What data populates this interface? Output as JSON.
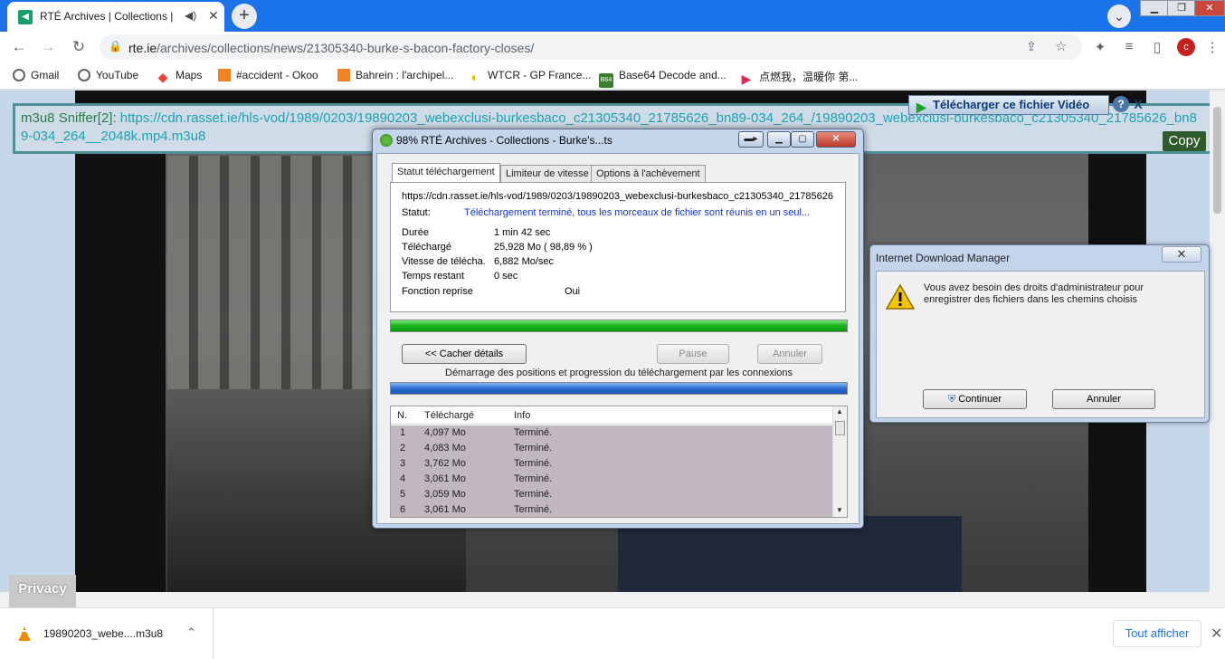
{
  "browser": {
    "tab_title": "RTÉ Archives | Collections | B",
    "tab_speaker": "◀)",
    "new_tab": "+",
    "url_domain": "rte.ie",
    "url_path": "/archives/collections/news/21305340-burke-s-bacon-factory-closes/",
    "profile_initial": "c",
    "bookmarks": [
      "Gmail",
      "YouTube",
      "Maps",
      "#accident - Okoo",
      "Bahrein : l'archipel...",
      "WTCR - GP France...",
      "Base64 Decode and...",
      "点燃我，温暖你 第..."
    ],
    "bookmark_icon_b64": "B64"
  },
  "page": {
    "sniffer_label": "m3u8 Sniffer[2]: ",
    "sniffer_url": "https://cdn.rasset.ie/hls-vod/1989/0203/19890203_webexclusi-burkesbaco_c21305340_21785626_bn89-034_264_/19890203_webexclusi-burkesbaco_c21305340_21785626_bn89-034_264__2048k.mp4.m3u8",
    "copy_label": "Copy",
    "tv_button": "Télécharger ce fichier Vidéo",
    "tv_help": "?",
    "tv_close": "X",
    "privacy": "Privacy"
  },
  "idm": {
    "title": "98% RTÉ Archives - Collections - Burke's...ts",
    "tabs": [
      "Statut téléchargement",
      "Limiteur de vitesse",
      "Options à l'achèvement"
    ],
    "url": "https://cdn.rasset.ie/hls-vod/1989/0203/19890203_webexclusi-burkesbaco_c21305340_21785626",
    "status_label": "Statut:",
    "status_value": "Téléchargement terminé, tous les morceaux de fichier sont réunis en un seul...",
    "rows": [
      {
        "label": "Durée",
        "value": "1 min 42 sec"
      },
      {
        "label": "Téléchargé",
        "value": "25,928  Mo  ( 98,89 % )"
      },
      {
        "label": "Vitesse de télécha.",
        "value": "6,882  Mo/sec"
      },
      {
        "label": "Temps restant",
        "value": "0 sec"
      },
      {
        "label": "Fonction reprise",
        "value": "Oui"
      }
    ],
    "progress_percent": 98.89,
    "btn_hide": "<< Cacher détails",
    "btn_pause": "Pause",
    "btn_cancel": "Annuler",
    "connections_label": "Démarrage des positions et progression du téléchargement par les connexions",
    "conn_headers": [
      "N.",
      "Téléchargé",
      "Info"
    ],
    "connections": [
      {
        "n": "1",
        "dl": "4,097  Mo",
        "info": "Terminé."
      },
      {
        "n": "2",
        "dl": "4,083  Mo",
        "info": "Terminé."
      },
      {
        "n": "3",
        "dl": "3,762  Mo",
        "info": "Terminé."
      },
      {
        "n": "4",
        "dl": "3,061  Mo",
        "info": "Terminé."
      },
      {
        "n": "5",
        "dl": "3,059  Mo",
        "info": "Terminé."
      },
      {
        "n": "6",
        "dl": "3,061  Mo",
        "info": "Terminé."
      }
    ]
  },
  "admin_dialog": {
    "title": "Internet Download Manager",
    "message": "Vous avez besoin des droits d'administrateur pour enregistrer des fichiers dans les chemins choisis",
    "continue": "Continuer",
    "cancel": "Annuler"
  },
  "download_shelf": {
    "filename": "19890203_webe....m3u8",
    "show_all": "Tout afficher"
  }
}
